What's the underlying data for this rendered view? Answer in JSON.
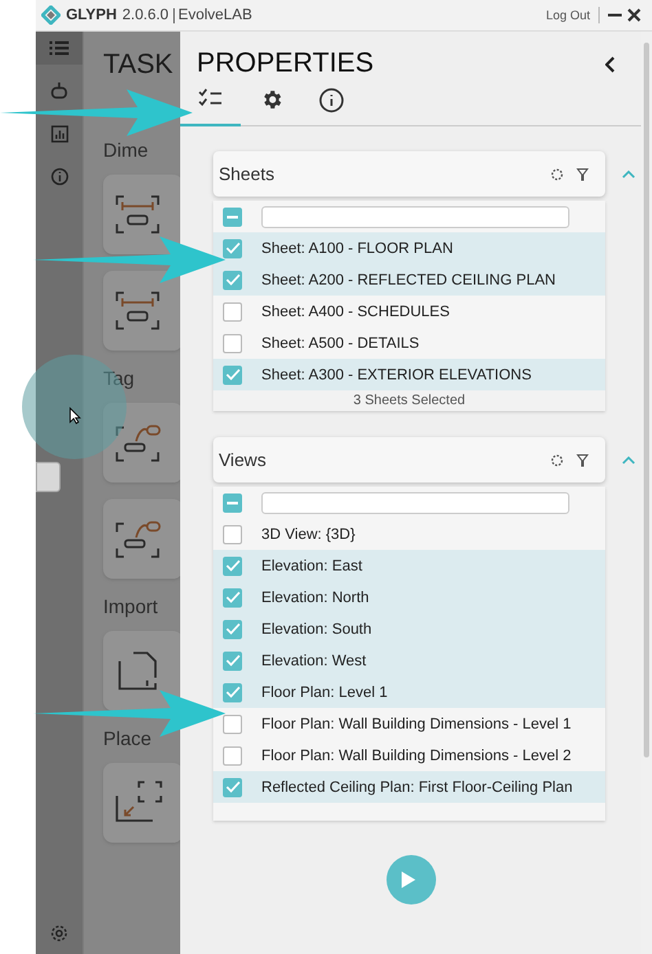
{
  "window": {
    "app": "GLYPH",
    "version": "2.0.6.0",
    "company": "EvolveLAB",
    "logout": "Log Out"
  },
  "rail": [
    {
      "kind": "list",
      "selected": true
    },
    {
      "kind": "robot",
      "selected": false
    },
    {
      "kind": "chart",
      "selected": false
    },
    {
      "kind": "info",
      "selected": false
    }
  ],
  "tasks": {
    "title": "TASK",
    "sections": [
      {
        "label": "Dime",
        "tiles": [
          {
            "kind": "dimension"
          },
          {
            "kind": "dimension"
          }
        ]
      },
      {
        "label": "Tag",
        "tiles": [
          {
            "kind": "tag"
          },
          {
            "kind": "tag"
          }
        ]
      },
      {
        "label": "Import",
        "tiles": [
          {
            "kind": "import"
          }
        ]
      },
      {
        "label": "Place",
        "tiles": [
          {
            "kind": "place"
          }
        ]
      }
    ]
  },
  "properties": {
    "title": "PROPERTIES",
    "tabs": [
      {
        "kind": "checklist",
        "selected": true
      },
      {
        "kind": "settings",
        "selected": false
      },
      {
        "kind": "info",
        "selected": false
      }
    ],
    "panels": [
      {
        "title": "Sheets",
        "expanded": true,
        "indeterminate": true,
        "items": [
          {
            "label": "Sheet: A100 - FLOOR PLAN",
            "checked": true
          },
          {
            "label": "Sheet: A200 - REFLECTED CEILING PLAN",
            "checked": true
          },
          {
            "label": "Sheet: A400 - SCHEDULES",
            "checked": false
          },
          {
            "label": "Sheet: A500 - DETAILS",
            "checked": false
          },
          {
            "label": "Sheet: A300 - EXTERIOR ELEVATIONS",
            "checked": true
          }
        ],
        "footer": "3 Sheets Selected"
      },
      {
        "title": "Views",
        "expanded": true,
        "indeterminate": true,
        "items": [
          {
            "label": "3D View: {3D}",
            "checked": false
          },
          {
            "label": "Elevation: East",
            "checked": true
          },
          {
            "label": "Elevation: North",
            "checked": true
          },
          {
            "label": "Elevation: South",
            "checked": true
          },
          {
            "label": "Elevation: West",
            "checked": true
          },
          {
            "label": "Floor Plan: Level 1",
            "checked": true
          },
          {
            "label": "Floor Plan: Wall Building Dimensions - Level 1",
            "checked": false
          },
          {
            "label": "Floor Plan: Wall Building Dimensions - Level 2",
            "checked": false
          },
          {
            "label": "Reflected Ceiling Plan: First Floor-Ceiling Plan",
            "checked": true
          }
        ]
      }
    ]
  }
}
